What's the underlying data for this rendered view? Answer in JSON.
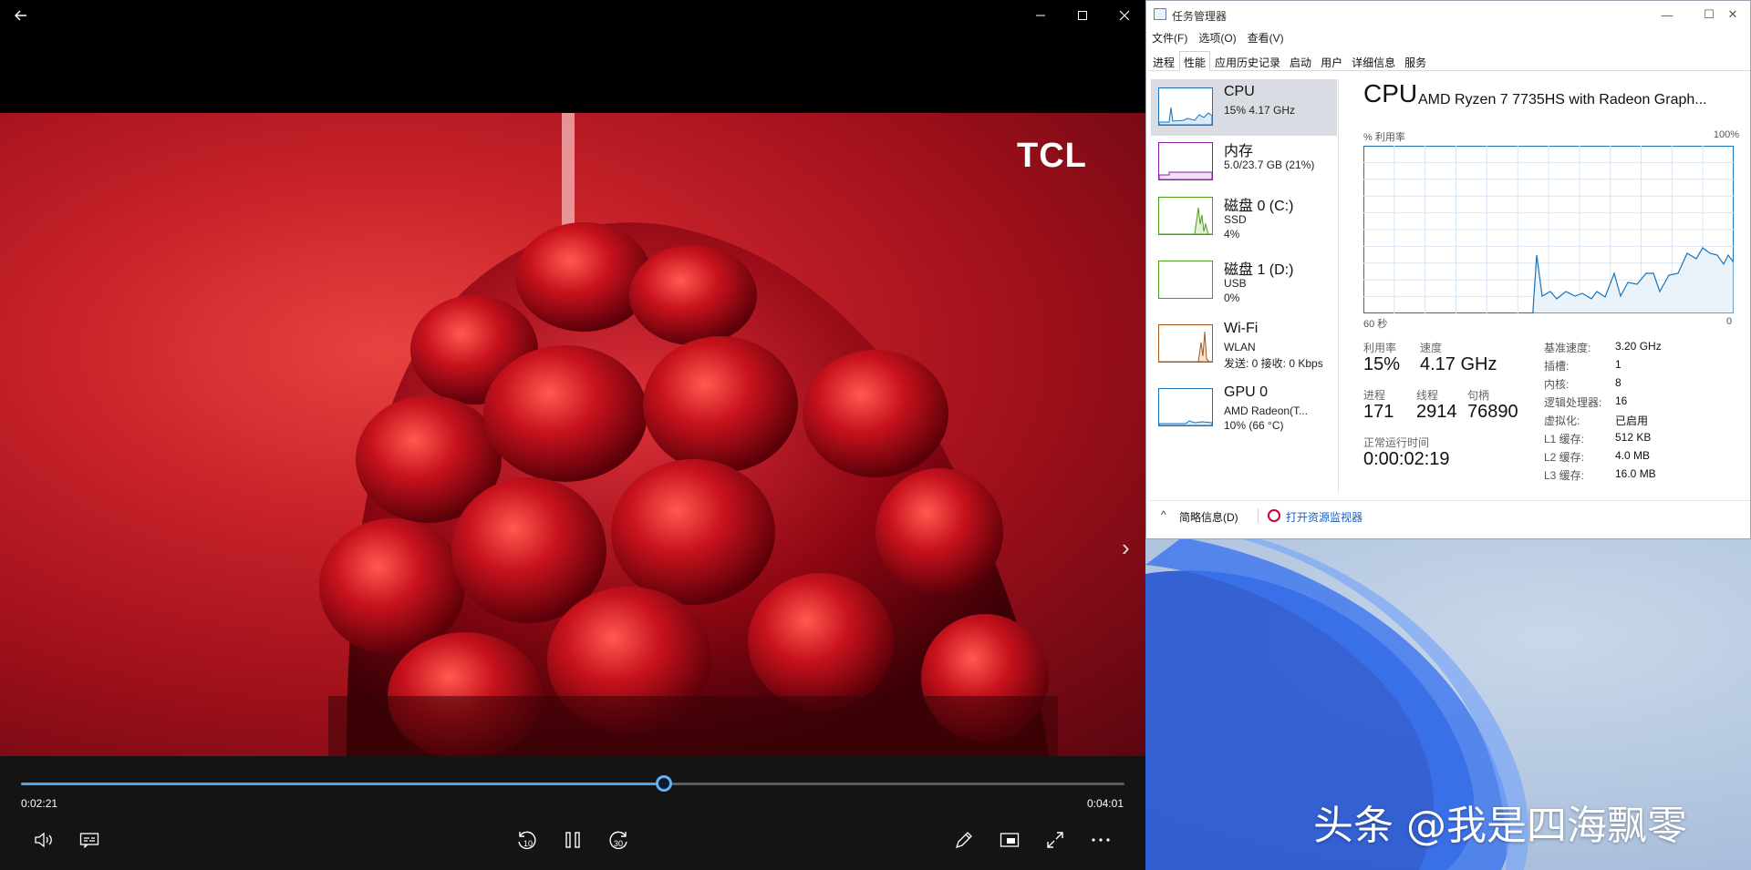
{
  "player": {
    "logo": "TCL",
    "time_elapsed": "0:02:21",
    "time_total": "0:04:01",
    "progress": 0.583
  },
  "taskmgr": {
    "title": "任务管理器",
    "menu": [
      "文件(F)",
      "选项(O)",
      "查看(V)"
    ],
    "tabs": [
      "进程",
      "性能",
      "应用历史记录",
      "启动",
      "用户",
      "详细信息",
      "服务"
    ],
    "active_tab": "性能",
    "sidebar": [
      {
        "name": "CPU",
        "lines": [
          "15% 4.17 GHz"
        ],
        "color": "#1a73b8"
      },
      {
        "name": "内存",
        "lines": [
          "5.0/23.7 GB (21%)"
        ],
        "color": "#8b1fa8"
      },
      {
        "name": "磁盘 0 (C:)",
        "lines": [
          "SSD",
          "4%"
        ],
        "color": "#4d9b1d"
      },
      {
        "name": "磁盘 1 (D:)",
        "lines": [
          "USB",
          "0%"
        ],
        "color": "#4d9b1d"
      },
      {
        "name": "Wi-Fi",
        "lines": [
          "WLAN",
          "发送: 0 接收: 0 Kbps"
        ],
        "color": "#a7561c"
      },
      {
        "name": "GPU 0",
        "lines": [
          "AMD Radeon(T...",
          "10% (66 °C)"
        ],
        "color": "#1a73b8"
      }
    ],
    "main": {
      "heading": "CPU",
      "model": "AMD Ryzen 7 7735HS with Radeon Graph...",
      "util_label": "% 利用率",
      "util_max": "100%",
      "graph_left": "60 秒",
      "graph_right": "0",
      "stats": {
        "util_label": "利用率",
        "util": "15%",
        "speed_label": "速度",
        "speed": "4.17 GHz",
        "proc_label": "进程",
        "proc": "171",
        "thread_label": "线程",
        "thread": "2914",
        "handle_label": "句柄",
        "handle": "76890",
        "uptime_label": "正常运行时间",
        "uptime": "0:00:02:19"
      },
      "specs": [
        {
          "label": "基准速度:",
          "value": "3.20 GHz"
        },
        {
          "label": "插槽:",
          "value": "1"
        },
        {
          "label": "内核:",
          "value": "8"
        },
        {
          "label": "逻辑处理器:",
          "value": "16"
        },
        {
          "label": "虚拟化:",
          "value": "已启用"
        },
        {
          "label": "L1 缓存:",
          "value": "512 KB"
        },
        {
          "label": "L2 缓存:",
          "value": "4.0 MB"
        },
        {
          "label": "L3 缓存:",
          "value": "16.0 MB"
        }
      ]
    },
    "footer": {
      "brief": "简略信息(D)",
      "monitor": "打开资源监视器"
    }
  },
  "watermark": "头条 @我是四海飘零"
}
